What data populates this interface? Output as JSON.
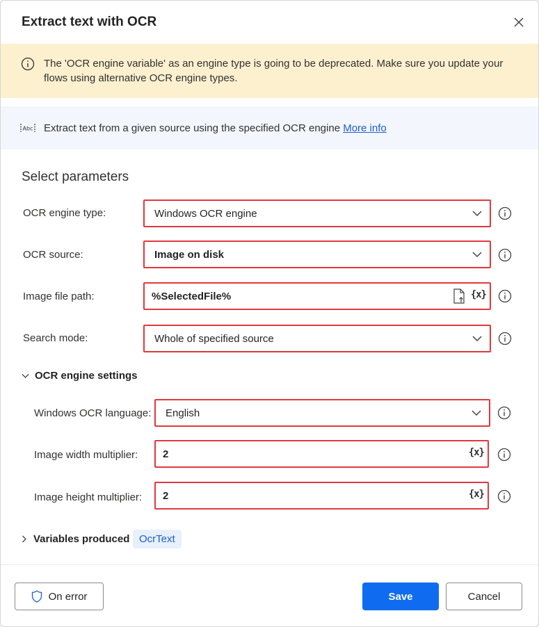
{
  "dialog": {
    "title": "Extract text with OCR",
    "close_icon": "close-icon"
  },
  "warning": {
    "icon": "info-circle-icon",
    "text": "The 'OCR engine variable' as an engine type is going to be deprecated.  Make sure you update your flows using alternative OCR engine types."
  },
  "info": {
    "icon": "abc-text-icon",
    "text": "Extract text from a given source using the specified OCR engine",
    "link": "More info"
  },
  "parameters": {
    "title": "Select parameters",
    "ocr_engine_type": {
      "label": "OCR engine type:",
      "value": "Windows OCR engine"
    },
    "ocr_source": {
      "label": "OCR source:",
      "value": "Image on disk"
    },
    "image_file_path": {
      "label": "Image file path:",
      "value": "%SelectedFile%"
    },
    "search_mode": {
      "label": "Search mode:",
      "value": "Whole of specified source"
    }
  },
  "engine_settings": {
    "title": "OCR engine settings",
    "language": {
      "label": "Windows OCR language:",
      "value": "English"
    },
    "width_multiplier": {
      "label": "Image width multiplier:",
      "value": "2"
    },
    "height_multiplier": {
      "label": "Image height multiplier:",
      "value": "2"
    }
  },
  "variables": {
    "title": "Variables produced",
    "chip": "OcrText"
  },
  "variable_button": "{x}",
  "footer": {
    "on_error": "On error",
    "save": "Save",
    "cancel": "Cancel"
  },
  "colors": {
    "accent": "#0f6cf0",
    "highlight_border": "#e0383e",
    "warning_bg": "#fcf0cf",
    "info_bg": "#f3f6fd"
  }
}
